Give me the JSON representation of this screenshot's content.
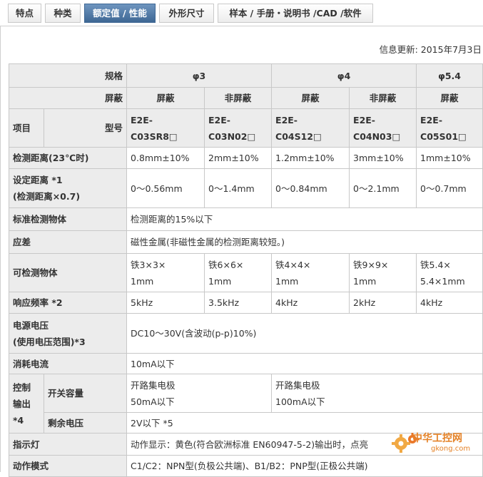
{
  "tabs": [
    "特点",
    "种类",
    "额定值 / 性能",
    "外形尺寸",
    "样本 / 手册・说明书 /CAD /软件"
  ],
  "update_text": "信息更新: 2015年7月3日",
  "table": {
    "spec_label": "规格",
    "shield_label": "屏蔽",
    "item_label": "项目",
    "model_label": "型号",
    "phi3": "φ3",
    "phi4": "φ4",
    "phi54": "φ5.4",
    "shield_cols": [
      "屏蔽",
      "非屏蔽",
      "屏蔽",
      "非屏蔽",
      "屏蔽"
    ],
    "models": [
      {
        "l1": "E2E-",
        "l2": "C03SR8□"
      },
      {
        "l1": "E2E-",
        "l2": "C03N02□"
      },
      {
        "l1": "E2E-",
        "l2": "C04S12□"
      },
      {
        "l1": "E2E-",
        "l2": "C04N03□"
      },
      {
        "l1": "E2E-",
        "l2": "C05S01□"
      }
    ],
    "detect_distance": {
      "label": "检测距离(23℃时)",
      "values": [
        "0.8mm±10%",
        "2mm±10%",
        "1.2mm±10%",
        "3mm±10%",
        "1mm±10%"
      ]
    },
    "set_distance": {
      "label1": "设定距离 *1",
      "label2": "(检测距离×0.7)",
      "values": [
        "0～0.56mm",
        "0～1.4mm",
        "0～0.84mm",
        "0～2.1mm",
        "0～0.7mm"
      ]
    },
    "standard_object": {
      "label": "标准检测物体",
      "value": "检测距离的15%以下"
    },
    "hysteresis": {
      "label": "应差",
      "value": "磁性金属(非磁性金属的检测距离较短。)"
    },
    "detectable": {
      "label": "可检测物体",
      "values": [
        {
          "l1": "铁3×3×",
          "l2": "1mm"
        },
        {
          "l1": "铁6×6×",
          "l2": "1mm"
        },
        {
          "l1": "铁4×4×",
          "l2": "1mm"
        },
        {
          "l1": "铁9×9×",
          "l2": "1mm"
        },
        {
          "l1": "铁5.4×",
          "l2": "5.4×1mm"
        }
      ]
    },
    "response": {
      "label": "响应频率 *2",
      "values": [
        "5kHz",
        "3.5kHz",
        "4kHz",
        "2kHz",
        "4kHz"
      ]
    },
    "power": {
      "label1": "电源电压",
      "label2": "(使用电压范围)*3",
      "value": "DC10～30V(含波动(p-p)10%)"
    },
    "current": {
      "label": "消耗电流",
      "value": "10mA以下"
    },
    "control": {
      "label1": "控制",
      "label2": "输出",
      "label3": "*4",
      "switch_label": "开关容量",
      "switch_a1": "开路集电极",
      "switch_a2": "50mA以下",
      "switch_b1": "开路集电极",
      "switch_b2": "100mA以下",
      "residual_label": "剩余电压",
      "residual_value": "2V以下 *5"
    },
    "indicator": {
      "label": "指示灯",
      "value": "动作显示：黄色(符合欧洲标准 EN60947-5-2)输出时，点亮"
    },
    "output_type": {
      "label": "动作模式",
      "value": "C1/C2：NPN型(负极公共端)、B1/B2：PNP型(正极公共端)"
    }
  },
  "watermark": {
    "text1": "中华工控网",
    "text2": "gkong.com"
  }
}
